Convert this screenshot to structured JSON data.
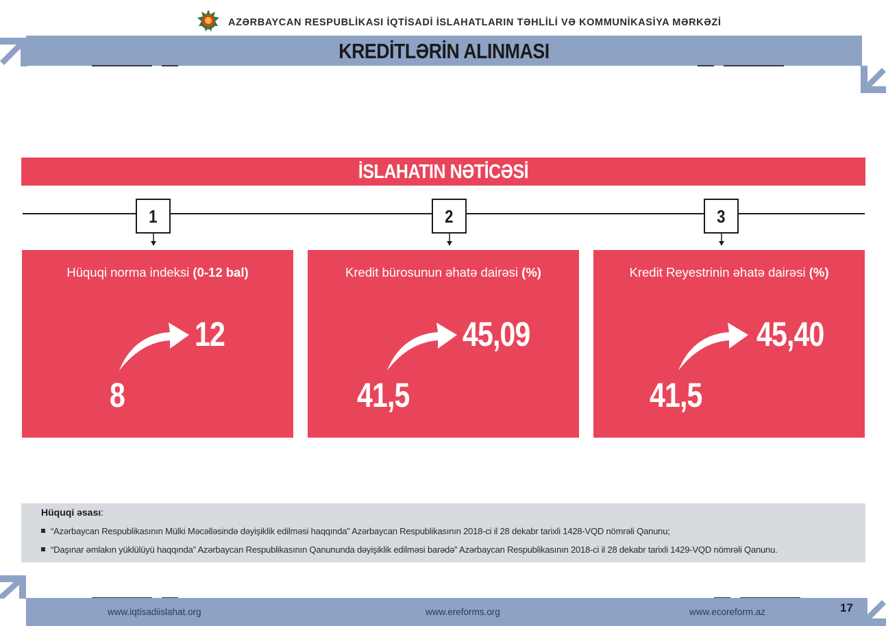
{
  "header": {
    "org_name": "AZƏRBAYCAN RESPUBLİKASI İQTİSADİ İSLAHATLARIN TƏHLİLİ VƏ KOMMUNİKASİYA MƏRKƏZİ",
    "page_title": "KREDİTLƏRİN ALINMASI"
  },
  "section": {
    "banner": "İSLAHATIN NƏTİCƏSİ"
  },
  "steps": [
    {
      "number": "1",
      "title_plain": "Hüquqi norma indeksi ",
      "title_bold": "(0-12 bal)",
      "from": "8",
      "to": "12"
    },
    {
      "number": "2",
      "title_plain": "Kredit bürosunun əhatə dairəsi ",
      "title_bold": "(%)",
      "from": "41,5",
      "to": "45,09"
    },
    {
      "number": "3",
      "title_plain": "Kredit Reyestrinin əhatə dairəsi ",
      "title_bold": "(%)",
      "from": "41,5",
      "to": "45,40"
    }
  ],
  "legal": {
    "title_bold": "Hüquqi əsası",
    "title_suffix": ":",
    "items": [
      "“Azərbaycan Respublikasının Mülki Məcəlləsində dəyişiklik edilməsi haqqında” Azərbaycan Respublikasının 2018-ci il 28 dekabr tarixli 1428-VQD nömrəli Qanunu;",
      "“Daşınar əmlakın yüklülüyü haqqında” Azərbaycan Respublikasının Qanununda dəyişiklik edilməsi barədə” Azərbaycan Respublikasının 2018-ci il 28 dekabr tarixli 1429-VQD nömrəli Qanunu."
    ]
  },
  "footer": {
    "links": [
      "www.iqtisadiislahat.org",
      "www.ereforms.org",
      "www.ecoreform.az"
    ],
    "page_number": "17"
  },
  "colors": {
    "accent_red": "#e9455a",
    "band_blue": "#8ea2c6",
    "legal_gray": "#d7dade"
  },
  "icons": [
    "state-emblem-icon",
    "corner-arrow-icon",
    "curved-arrow-icon"
  ]
}
